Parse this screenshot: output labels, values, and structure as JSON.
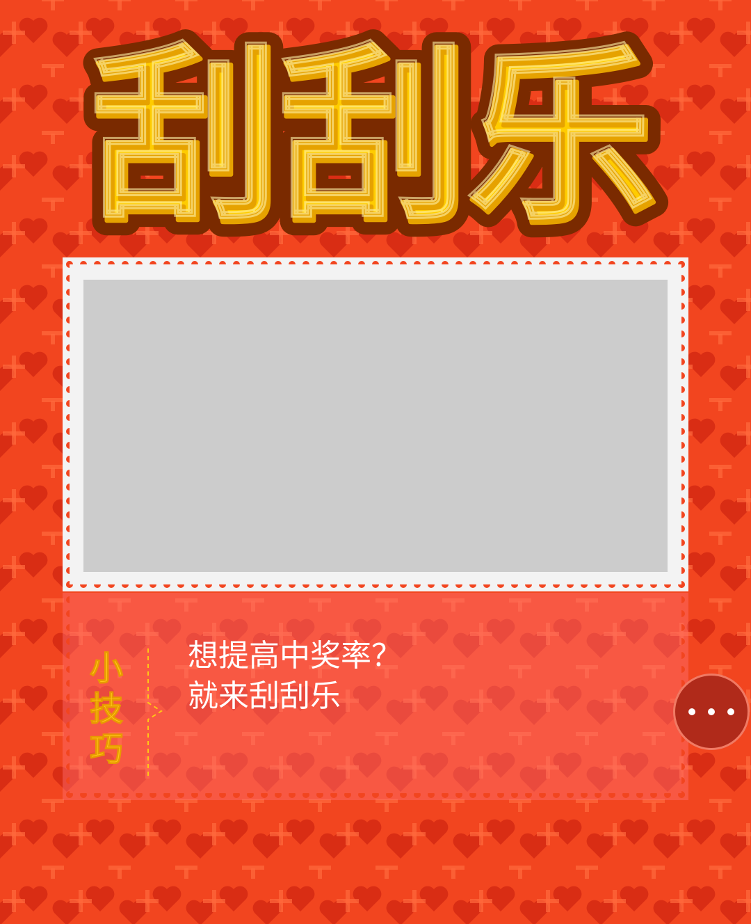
{
  "title": {
    "text": "刮刮乐"
  },
  "scratch_card": {
    "state": "unscratched"
  },
  "tip": {
    "label": [
      "小",
      "技",
      "巧"
    ],
    "lines": [
      "想提高中奖率？",
      "就来刮刮乐"
    ]
  },
  "menu": {
    "icon": "more-dots-icon"
  },
  "colors": {
    "background": "#f2451f",
    "heart": "#d92d14",
    "cross": "#ff6a3d",
    "scratch_surface": "#cccccc",
    "card_border": "#f3f3f3",
    "title_fill": "#ffcc00",
    "title_outline": "#7a2a00",
    "tip_label": "#ffc617"
  }
}
